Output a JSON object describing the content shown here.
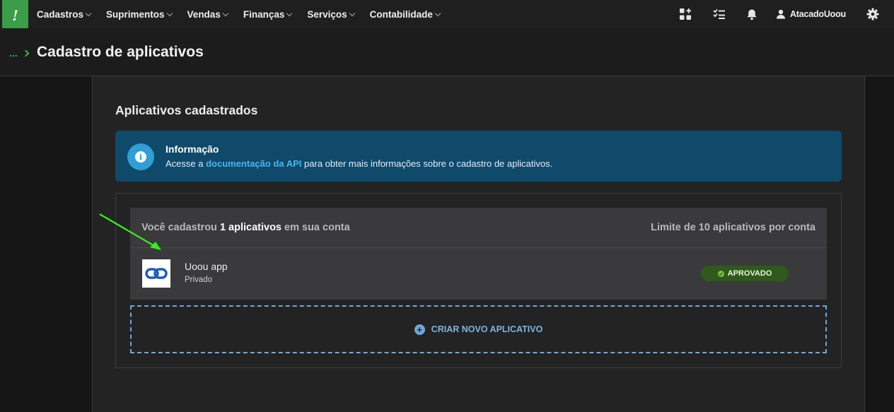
{
  "nav": {
    "logo_glyph": "!",
    "menu": [
      {
        "label": "Cadastros"
      },
      {
        "label": "Suprimentos"
      },
      {
        "label": "Vendas"
      },
      {
        "label": "Finanças"
      },
      {
        "label": "Serviços"
      },
      {
        "label": "Contabilidade"
      }
    ],
    "right_icons": [
      "apps-grid-icon",
      "checklist-icon",
      "bell-icon"
    ],
    "user_name": "AtacadoUoou",
    "settings_icon": "gear-icon"
  },
  "header": {
    "breadcrumb": "...",
    "title": "Cadastro de aplicativos"
  },
  "main": {
    "section_title": "Aplicativos cadastrados",
    "info": {
      "title": "Informação",
      "text_before": "Acesse a ",
      "link": "documentação da API",
      "text_after": " para obter mais informações sobre o cadastro de aplicativos."
    },
    "apps": {
      "count_prefix": "Você cadastrou ",
      "count_bold": "1 aplicativos",
      "count_suffix": " em sua conta",
      "limit": "Limite de 10 aplicativos por conta",
      "items": [
        {
          "name": "Uoou app",
          "visibility": "Privado",
          "status": "APROVADO"
        }
      ]
    },
    "new_app_label": "CRIAR NOVO APLICATIVO"
  },
  "colors": {
    "accent_green": "#3ab54a",
    "info_bg": "#0f4a6b",
    "link_blue": "#49b5ee",
    "approved_bg": "#2f5a1b",
    "dashed_blue": "#6fa8d6",
    "annotation_arrow": "#33ee22"
  }
}
